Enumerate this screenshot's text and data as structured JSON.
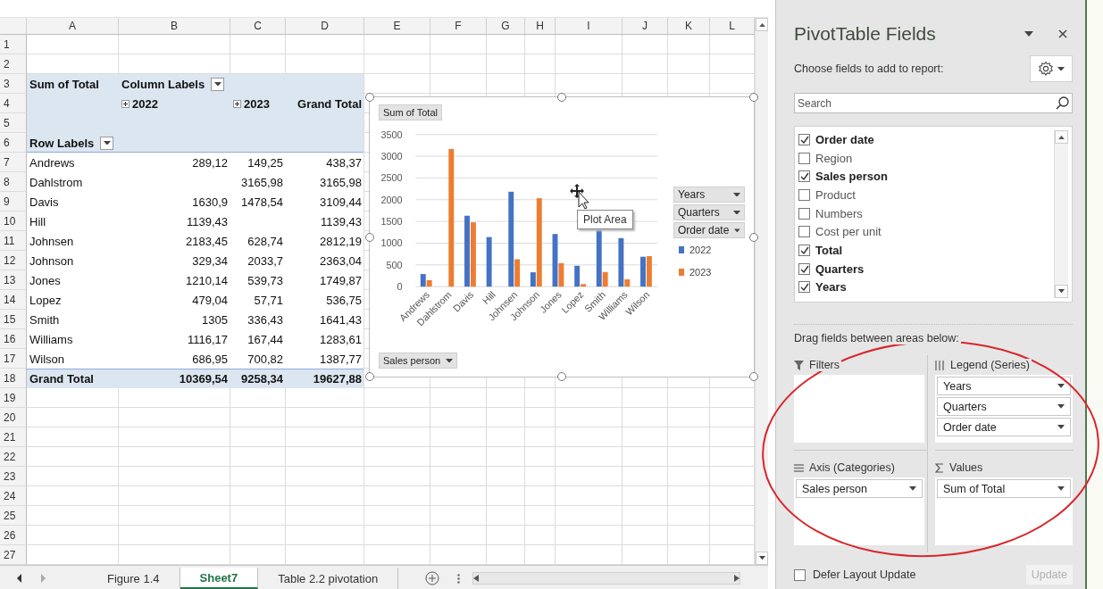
{
  "sheet": {
    "columns": [
      "A",
      "B",
      "C",
      "D",
      "E",
      "F",
      "G",
      "H",
      "I",
      "J",
      "K",
      "L"
    ],
    "rows": [
      {
        "number": "1",
        "kind": "blank"
      },
      {
        "number": "2",
        "kind": "blank"
      },
      {
        "number": "3",
        "kind": "header",
        "cells": {
          "A": {
            "text": "Sum of Total"
          },
          "B": {
            "text": "Column Labels",
            "dropdown": true
          }
        }
      },
      {
        "number": "4",
        "kind": "header",
        "cells": {
          "B": {
            "text": "2022",
            "expandable": true
          },
          "C": {
            "text": "2023",
            "expandable": true
          },
          "D": {
            "text": "Grand Total"
          }
        }
      },
      {
        "number": "5",
        "kind": "header"
      },
      {
        "number": "6",
        "kind": "header",
        "cells": {
          "A": {
            "text": "Row Labels",
            "dropdown": true
          }
        }
      },
      {
        "number": "7",
        "kind": "data",
        "cells": {
          "A": {
            "text": "Andrews"
          },
          "B": {
            "text": "289,12"
          },
          "C": {
            "text": "149,25"
          },
          "D": {
            "text": "438,37"
          }
        }
      },
      {
        "number": "8",
        "kind": "data",
        "cells": {
          "A": {
            "text": "Dahlstrom"
          },
          "C": {
            "text": "3165,98"
          },
          "D": {
            "text": "3165,98"
          }
        }
      },
      {
        "number": "9",
        "kind": "data",
        "cells": {
          "A": {
            "text": "Davis"
          },
          "B": {
            "text": "1630,9"
          },
          "C": {
            "text": "1478,54"
          },
          "D": {
            "text": "3109,44"
          }
        }
      },
      {
        "number": "10",
        "kind": "data",
        "cells": {
          "A": {
            "text": "Hill"
          },
          "B": {
            "text": "1139,43"
          },
          "D": {
            "text": "1139,43"
          }
        }
      },
      {
        "number": "11",
        "kind": "data",
        "cells": {
          "A": {
            "text": "Johnsen"
          },
          "B": {
            "text": "2183,45"
          },
          "C": {
            "text": "628,74"
          },
          "D": {
            "text": "2812,19"
          }
        }
      },
      {
        "number": "12",
        "kind": "data",
        "cells": {
          "A": {
            "text": "Johnson"
          },
          "B": {
            "text": "329,34"
          },
          "C": {
            "text": "2033,7"
          },
          "D": {
            "text": "2363,04"
          }
        }
      },
      {
        "number": "13",
        "kind": "data",
        "cells": {
          "A": {
            "text": "Jones"
          },
          "B": {
            "text": "1210,14"
          },
          "C": {
            "text": "539,73"
          },
          "D": {
            "text": "1749,87"
          }
        }
      },
      {
        "number": "14",
        "kind": "data",
        "cells": {
          "A": {
            "text": "Lopez"
          },
          "B": {
            "text": "479,04"
          },
          "C": {
            "text": "57,71"
          },
          "D": {
            "text": "536,75"
          }
        }
      },
      {
        "number": "15",
        "kind": "data",
        "cells": {
          "A": {
            "text": "Smith"
          },
          "B": {
            "text": "1305"
          },
          "C": {
            "text": "336,43"
          },
          "D": {
            "text": "1641,43"
          }
        }
      },
      {
        "number": "16",
        "kind": "data",
        "cells": {
          "A": {
            "text": "Williams"
          },
          "B": {
            "text": "1116,17"
          },
          "C": {
            "text": "167,44"
          },
          "D": {
            "text": "1283,61"
          }
        }
      },
      {
        "number": "17",
        "kind": "data",
        "cells": {
          "A": {
            "text": "Wilson"
          },
          "B": {
            "text": "686,95"
          },
          "C": {
            "text": "700,82"
          },
          "D": {
            "text": "1387,77"
          }
        }
      },
      {
        "number": "18",
        "kind": "total",
        "cells": {
          "A": {
            "text": "Grand Total"
          },
          "B": {
            "text": "10369,54"
          },
          "C": {
            "text": "9258,34"
          },
          "D": {
            "text": "19627,88"
          }
        }
      },
      {
        "number": "19",
        "kind": "blank"
      },
      {
        "number": "20",
        "kind": "blank"
      },
      {
        "number": "21",
        "kind": "blank"
      },
      {
        "number": "22",
        "kind": "blank"
      },
      {
        "number": "23",
        "kind": "blank"
      },
      {
        "number": "24",
        "kind": "blank"
      },
      {
        "number": "25",
        "kind": "blank"
      },
      {
        "number": "26",
        "kind": "blank"
      },
      {
        "number": "27",
        "kind": "blank"
      }
    ]
  },
  "chart": {
    "value_button": "Sum of Total",
    "axis_button": "Sales person",
    "legend_buttons": [
      "Years",
      "Quarters",
      "Order date"
    ],
    "tooltip": "Plot Area",
    "chart_data": {
      "type": "bar",
      "categories": [
        "Andrews",
        "Dahlstrom",
        "Davis",
        "Hill",
        "Johnsen",
        "Johnson",
        "Jones",
        "Lopez",
        "Smith",
        "Williams",
        "Wilson"
      ],
      "series": [
        {
          "name": "2022",
          "color": "#4472c4",
          "values": [
            289.12,
            null,
            1630.9,
            1139.43,
            2183.45,
            329.34,
            1210.14,
            479.04,
            1305,
            1116.17,
            686.95
          ]
        },
        {
          "name": "2023",
          "color": "#ed7d31",
          "values": [
            149.25,
            3165.98,
            1478.54,
            null,
            628.74,
            2033.7,
            539.73,
            57.71,
            336.43,
            167.44,
            700.82
          ]
        }
      ],
      "grid": true,
      "ylim": [
        0,
        3500
      ],
      "yticks": [
        0,
        500,
        1000,
        1500,
        2000,
        2500,
        3000,
        3500
      ]
    }
  },
  "tabs": [
    {
      "label": "Figure 1.4",
      "selected": false
    },
    {
      "label": "Sheet7",
      "selected": true
    },
    {
      "label": "Table 2.2 pivotation",
      "selected": false
    }
  ],
  "panel": {
    "title": "PivotTable Fields",
    "subtitle": "Choose fields to add to report:",
    "search": {
      "placeholder": "Search"
    },
    "fields": [
      {
        "label": "Order date",
        "checked": true
      },
      {
        "label": "Region",
        "checked": false
      },
      {
        "label": "Sales person",
        "checked": true
      },
      {
        "label": "Product",
        "checked": false
      },
      {
        "label": "Numbers",
        "checked": false
      },
      {
        "label": "Cost per unit",
        "checked": false
      },
      {
        "label": "Total",
        "checked": true
      },
      {
        "label": "Quarters",
        "checked": true
      },
      {
        "label": "Years",
        "checked": true
      }
    ],
    "areas_hint": "Drag fields between areas below:",
    "areas": [
      {
        "kind": "filters",
        "title": "Filters"
      },
      {
        "kind": "legend",
        "title": "Legend (Series)",
        "items": [
          "Years",
          "Quarters",
          "Order date"
        ]
      },
      {
        "kind": "axis",
        "title": "Axis (Categories)",
        "items": [
          "Sales person"
        ]
      },
      {
        "kind": "values",
        "title": "Values",
        "items": [
          "Sum of Total"
        ]
      }
    ],
    "defer": {
      "label": "Defer Layout Update",
      "checked": false
    },
    "update_button": {
      "label": "Update",
      "disabled": true
    }
  }
}
